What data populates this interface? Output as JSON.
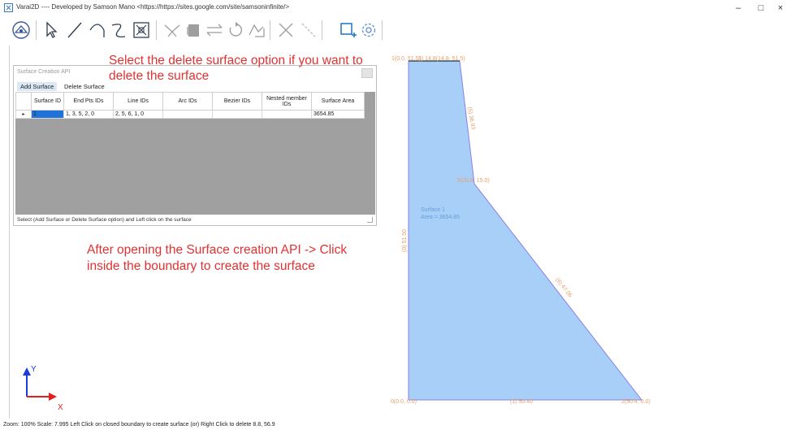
{
  "window": {
    "title": "Varai2D ---- Developed by Samson Mano <https://https://sites.google.com/site/samsoninfinite/>",
    "minimize": "–",
    "maximize": "□",
    "close": "×"
  },
  "toolbar": {
    "items": [
      "home-icon",
      "select-icon",
      "line-icon",
      "arc-icon",
      "bezier-icon",
      "zoom-fit-icon",
      "trim-icon",
      "delete-block-icon",
      "mirror-icon",
      "rotate-icon",
      "scale-icon",
      "cross-icon",
      "diagonal-icon",
      "surface-icon",
      "settings-icon"
    ]
  },
  "panel": {
    "title": "Surface Creation API",
    "tabs": [
      "Add Surface",
      "Delete Surface"
    ],
    "columns": [
      "Surface ID",
      "End Pts IDs",
      "Line IDs",
      "Arc IDs",
      "Bezier IDs",
      "Nested member IDs",
      "Surface Area"
    ],
    "rows": [
      {
        "marker": "▸",
        "surface_id": "1",
        "end_pts": "1, 3, 5, 2, 0",
        "line_ids": "2, 5, 6, 1, 0",
        "arc_ids": "",
        "bezier_ids": "",
        "nested": "",
        "area": "3654.85"
      }
    ],
    "status": "Select (Add Surface or Delete Surface option) and Left click on the surface"
  },
  "annotations": {
    "delete_line1": "Select the delete surface option if you want to",
    "delete_line2": "delete the surface",
    "create_line1": "After opening the Surface creation API -> Click",
    "create_line2": "inside the boundary to create the surface"
  },
  "drawing": {
    "points": {
      "p1": "1(0.0, 51.5)",
      "p3": "3) 14.8(14.8, 51.5)",
      "p5": "5(20.8, 15.0)",
      "p0": "0(0.0, 0.0)",
      "p2": "2(50.4, 0.0)"
    },
    "lines": {
      "l5": "(5) 36.93",
      "l6": "(6) 47.06",
      "l0": "(0) 51.50",
      "l1": "(1) 50.40"
    },
    "surface_label": "Surface 1",
    "surface_area": "Area = 3654.85",
    "colors": {
      "fill": "#a8cff7",
      "edge": "#8a7fe6",
      "dim": "#e6a06a",
      "surface_text": "#6a9cd8"
    }
  },
  "axes": {
    "x": "X",
    "y": "Y"
  },
  "status_bar": "Zoom: 100%  Scale: 7.995    Left Click on closed boundary to create surface (or) Right Click to delete  8.8, 56.9"
}
